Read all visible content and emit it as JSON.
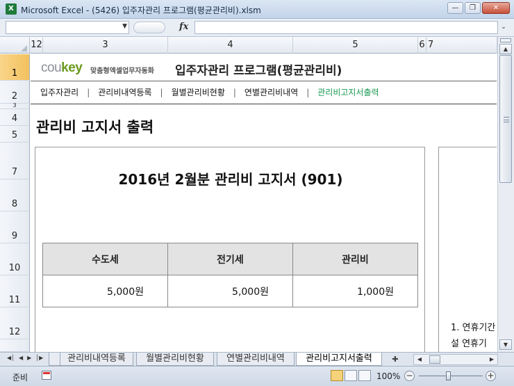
{
  "window": {
    "title": "Microsoft Excel - (5426) 입주자관리 프로그램(평균관리비).xlsm",
    "app_icon": "excel-icon",
    "buttons": {
      "minimize": "minimize-icon",
      "restore": "restore-icon",
      "close": "close-icon"
    }
  },
  "formula_bar": {
    "name_box": "",
    "fx_label": "fx",
    "formula": ""
  },
  "columns": [
    "12",
    "3",
    "4",
    "5",
    "6",
    "7"
  ],
  "rows": [
    "1",
    "2",
    "3",
    "4",
    "5",
    "7",
    "8",
    "9",
    "10",
    "11",
    "12"
  ],
  "sheet": {
    "brand_logo": "coukey",
    "brand_logo_parts": {
      "cou": "cou",
      "key": "key"
    },
    "brand_tagline": "맞춤형엑셀업무자동화",
    "program_title": "입주자관리 프로그램(평균관리비)",
    "nav": {
      "items": [
        {
          "label": "입주자관리",
          "active": false
        },
        {
          "label": "관리비내역등록",
          "active": false
        },
        {
          "label": "월별관리비현황",
          "active": false
        },
        {
          "label": "연별관리비내역",
          "active": false
        },
        {
          "label": "관리비고지서출력",
          "active": true
        }
      ],
      "separator": "|",
      "active_color": "#1a9a52"
    },
    "page_title": "관리비 고지서 출력",
    "invoice": {
      "title": "2016년 2월분 관리비 고지서 (901)",
      "table": {
        "headers": [
          "수도세",
          "전기세",
          "관리비"
        ],
        "values": [
          "5,000원",
          "5,000원",
          "1,000원"
        ]
      }
    },
    "notes": [
      "1. 연휴기간",
      "설 연휴기"
    ]
  },
  "sheet_tabs": {
    "tabs": [
      {
        "label": "관리비내역등록",
        "active": false
      },
      {
        "label": "월별관리비현황",
        "active": false
      },
      {
        "label": "연별관리비내역",
        "active": false
      },
      {
        "label": "관리비고지서출력",
        "active": true
      }
    ],
    "new_sheet_icon": "new-sheet-icon"
  },
  "status_bar": {
    "status": "준비",
    "zoom": "100%"
  }
}
